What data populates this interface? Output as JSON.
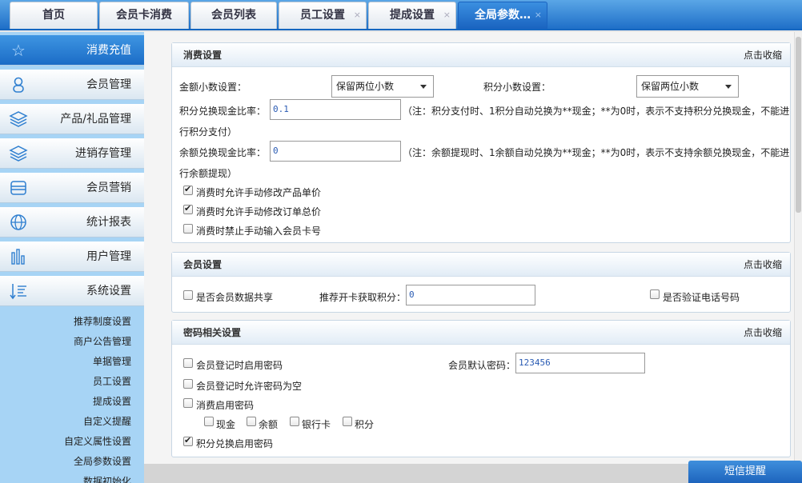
{
  "tabs": [
    {
      "label": "首页",
      "closable": false
    },
    {
      "label": "会员卡消费",
      "closable": false
    },
    {
      "label": "会员列表",
      "closable": false
    },
    {
      "label": "员工设置",
      "closable": true
    },
    {
      "label": "提成设置",
      "closable": true
    },
    {
      "label": "全局参数…",
      "closable": true,
      "active": true
    }
  ],
  "sidebar": {
    "items": [
      {
        "label": "消费充值",
        "icon": "star-icon",
        "active": true
      },
      {
        "label": "会员管理",
        "icon": "user-icon"
      },
      {
        "label": "产品/礼品管理",
        "icon": "layers-icon"
      },
      {
        "label": "进销存管理",
        "icon": "layers-icon"
      },
      {
        "label": "会员营销",
        "icon": "card-stack-icon"
      },
      {
        "label": "统计报表",
        "icon": "globe-icon"
      },
      {
        "label": "用户管理",
        "icon": "bar-chart-icon"
      },
      {
        "label": "系统设置",
        "icon": "sort-list-icon"
      }
    ],
    "subitems": [
      "推荐制度设置",
      "商户公告管理",
      "单据管理",
      "员工设置",
      "提成设置",
      "自定义提醒",
      "自定义属性设置",
      "全局参数设置",
      "数据初始化"
    ]
  },
  "consume": {
    "title": "消费设置",
    "collapse": "点击收缩",
    "amount_decimal_label": "金额小数设置：",
    "amount_decimal_value": "保留两位小数",
    "points_decimal_label": "积分小数设置：",
    "points_decimal_value": "保留两位小数",
    "points_ratio_label": "积分兑换现金比率：",
    "points_ratio_value": "0.1",
    "points_note_1": "（注：积分支付时、1积分自动兑换为**现金；**为0时，表示不支持积分兑换现金，不能进",
    "points_note_2": "行积分支付）",
    "balance_ratio_label": "余额兑换现金比率：",
    "balance_ratio_value": "0",
    "balance_note_1": "（注：余额提现时、1余额自动兑换为**现金；**为0时，表示不支持余额兑换现金，不能进",
    "balance_note_2": "行余额提现）",
    "checks": [
      {
        "label": "消费时允许手动修改产品单价",
        "checked": true
      },
      {
        "label": "消费时允许手动修改订单总价",
        "checked": true
      },
      {
        "label": "消费时禁止手动输入会员卡号",
        "checked": false
      }
    ]
  },
  "member": {
    "title": "会员设置",
    "collapse": "点击收缩",
    "share_label": "是否会员数据共享",
    "share_checked": false,
    "referral_label": "推荐开卡获取积分：",
    "referral_value": "0",
    "verify_phone_label": "是否验证电话号码",
    "verify_phone_checked": false
  },
  "password": {
    "title": "密码相关设置",
    "collapse": "点击收缩",
    "register_pwd_label": "会员登记时启用密码",
    "register_pwd_checked": false,
    "default_pwd_label": "会员默认密码：",
    "default_pwd_value": "123456",
    "allow_empty_label": "会员登记时允许密码为空",
    "allow_empty_checked": false,
    "consume_pwd_label": "消费启用密码",
    "consume_pwd_checked": false,
    "pay_methods": [
      {
        "label": "现金",
        "checked": false
      },
      {
        "label": "余额",
        "checked": false
      },
      {
        "label": "银行卡",
        "checked": false
      },
      {
        "label": "积分",
        "checked": false
      }
    ],
    "points_pwd_label": "积分兑换启用密码",
    "points_pwd_checked": true
  },
  "sms_button": "短信提醒",
  "colors": {
    "accent": "#1f6fc8",
    "sidebar_bg": "#a7d4f5"
  }
}
